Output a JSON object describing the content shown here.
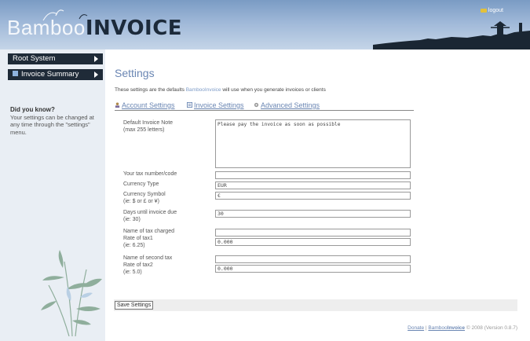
{
  "header": {
    "logo_part1": "Bamboo",
    "logo_part2": "INVOICE",
    "logout_label": "logout"
  },
  "sidebar": {
    "items": [
      {
        "label": "Root System"
      },
      {
        "label": "Invoice Summary"
      }
    ],
    "tip_title": "Did you know?",
    "tip_body": "Your settings can be changed at any time through the \"settings\" menu."
  },
  "main": {
    "title": "Settings",
    "intro_before": "These settings are the defaults ",
    "intro_brand": "BambooInvoice",
    "intro_after": " will use when you generate invoices or clients",
    "tabs": [
      {
        "label": "Account Settings",
        "icon": "account-icon"
      },
      {
        "label": "Invoice Settings",
        "icon": "invoice-icon"
      },
      {
        "label": "Advanced Settings",
        "icon": "gear-icon"
      }
    ]
  },
  "form": {
    "note_label_1": "Default Invoice Note",
    "note_label_2": "(max 255 letters)",
    "note_value": "Please pay the invoice as soon as possible",
    "tax_code_label": "Your tax number/code",
    "tax_code_value": "",
    "currency_type_label": "Currency Type",
    "currency_type_value": "EUR",
    "currency_symbol_label_1": "Currency Symbol",
    "currency_symbol_label_2": "(ie: $ or £ or ¥)",
    "currency_symbol_value": "€",
    "days_due_label_1": "Days until invoice due",
    "days_due_label_2": "(ie: 30)",
    "days_due_value": "30",
    "tax1_name_label": "Name of tax charged",
    "tax1_name_value": "",
    "tax1_rate_label_1": "Rate of tax1",
    "tax1_rate_label_2": "(ie: 6.25)",
    "tax1_rate_value": "0.000",
    "tax2_name_label": "Name of second tax",
    "tax2_name_value": "",
    "tax2_rate_label_1": "Rate of tax2",
    "tax2_rate_label_2": "(ie: 5.0)",
    "tax2_rate_value": "0.000",
    "save_label": "Save Settings"
  },
  "footer": {
    "donate": "Donate",
    "sep": " | ",
    "brand_1": "Bamboo",
    "brand_2": "Invoice",
    "rest": " © 2008 (Version 0.8.7)"
  }
}
